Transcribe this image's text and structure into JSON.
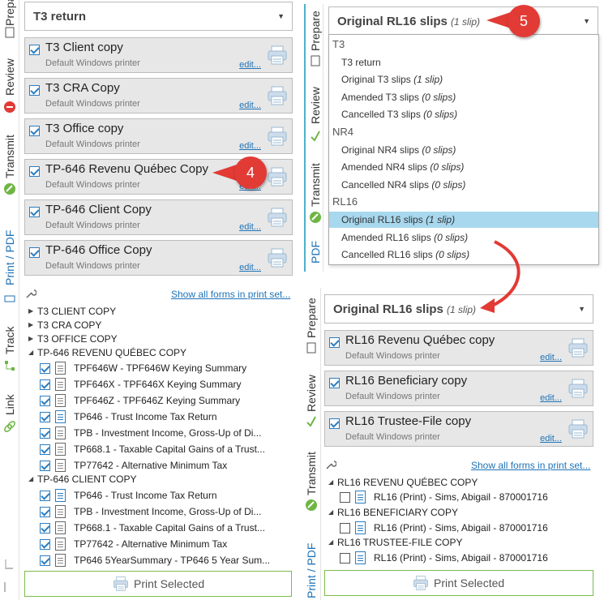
{
  "vtabs_left": {
    "prepare": "Prepare",
    "review": "Review",
    "transmit": "Transmit",
    "print_pdf": "Print / PDF",
    "track": "Track",
    "link": "Link"
  },
  "vtabs_right_top": {
    "prepare": "Prepare",
    "review": "Review",
    "transmit": "Transmit",
    "pdf": "PDF"
  },
  "vtabs_right_bottom": {
    "prepare": "Prepare",
    "review": "Review",
    "transmit": "Transmit",
    "print_pdf": "Print / PDF"
  },
  "left": {
    "dropdown": "T3 return",
    "cards": [
      {
        "title": "T3 Client copy",
        "sub": "Default Windows printer",
        "edit": "edit..."
      },
      {
        "title": "T3 CRA Copy",
        "sub": "Default Windows printer",
        "edit": "edit..."
      },
      {
        "title": "T3 Office copy",
        "sub": "Default Windows printer",
        "edit": "edit..."
      },
      {
        "title": "TP-646 Revenu Québec Copy",
        "sub": "Default Windows printer",
        "edit": "edit..."
      },
      {
        "title": "TP-646 Client Copy",
        "sub": "Default Windows printer",
        "edit": "edit..."
      },
      {
        "title": "TP-646 Office Copy",
        "sub": "Default Windows printer",
        "edit": "edit..."
      }
    ],
    "show_all": "Show all forms in print set...",
    "tree": [
      {
        "label": "T3 CLIENT COPY"
      },
      {
        "label": "T3 CRA COPY"
      },
      {
        "label": "T3 OFFICE COPY"
      },
      {
        "label": "TP-646 REVENU QUÉBEC COPY"
      },
      {
        "label": "TPF646W - TPF646W Keying Summary"
      },
      {
        "label": "TPF646X - TPF646X Keying Summary"
      },
      {
        "label": "TPF646Z - TPF646Z Keying Summary"
      },
      {
        "label": "TP646 - Trust Income Tax Return"
      },
      {
        "label": "TPB - Investment Income, Gross-Up of Di..."
      },
      {
        "label": "TP668.1 - Taxable Capital Gains of a Trust..."
      },
      {
        "label": "TP77642 - Alternative Minimum Tax"
      },
      {
        "label": "TP-646 CLIENT COPY"
      },
      {
        "label": "TP646 - Trust Income Tax Return"
      },
      {
        "label": "TPB - Investment Income, Gross-Up of Di..."
      },
      {
        "label": "TP668.1 - Taxable Capital Gains of a Trust..."
      },
      {
        "label": "TP77642 - Alternative Minimum Tax"
      },
      {
        "label": "TP646 5YearSummary - TP646 5 Year Sum..."
      }
    ],
    "print_btn": "Print Selected"
  },
  "callout4": "4",
  "callout5": "5",
  "right_top": {
    "dropdown_bold": "Original RL16 slips",
    "dropdown_meta": "(1 slip)",
    "menu": [
      {
        "label": "T3",
        "meta": ""
      },
      {
        "label": "T3 return",
        "meta": ""
      },
      {
        "label": "Original T3 slips",
        "meta": "(1 slip)"
      },
      {
        "label": "Amended T3 slips",
        "meta": "(0 slips)"
      },
      {
        "label": "Cancelled T3 slips",
        "meta": "(0 slips)"
      },
      {
        "label": "NR4",
        "meta": ""
      },
      {
        "label": "Original NR4 slips",
        "meta": "(0 slips)"
      },
      {
        "label": "Amended NR4 slips",
        "meta": "(0 slips)"
      },
      {
        "label": "Cancelled NR4 slips",
        "meta": "(0 slips)"
      },
      {
        "label": "RL16",
        "meta": ""
      },
      {
        "label": "Original RL16 slips",
        "meta": "(1 slip)"
      },
      {
        "label": "Amended RL16 slips",
        "meta": "(0 slips)"
      },
      {
        "label": "Cancelled RL16 slips",
        "meta": "(0 slips)"
      }
    ]
  },
  "right_bottom": {
    "dropdown_bold": "Original RL16 slips",
    "dropdown_meta": "(1 slip)",
    "cards": [
      {
        "title": "RL16 Revenu Québec copy",
        "sub": "Default Windows printer",
        "edit": "edit..."
      },
      {
        "title": "RL16 Beneficiary copy",
        "sub": "Default Windows printer",
        "edit": "edit..."
      },
      {
        "title": "RL16 Trustee-File copy",
        "sub": "Default Windows printer",
        "edit": "edit..."
      }
    ],
    "show_all": "Show all forms in print set...",
    "tree": [
      {
        "label": "RL16 REVENU QUÉBEC COPY"
      },
      {
        "label": "RL16 (Print) - Sims, Abigail - 870001716"
      },
      {
        "label": "RL16 BENEFICIARY COPY"
      },
      {
        "label": "RL16 (Print) - Sims, Abigail - 870001716"
      },
      {
        "label": "RL16 TRUSTEE-FILE COPY"
      },
      {
        "label": "RL16 (Print) - Sims, Abigail - 870001716"
      }
    ],
    "print_btn": "Print Selected"
  },
  "colors": {
    "accent": "#1f73b7",
    "callout": "#e23a35",
    "check": "#2c7dc0",
    "selection": "#a8d8ee",
    "button_border": "#7dbb4c"
  }
}
